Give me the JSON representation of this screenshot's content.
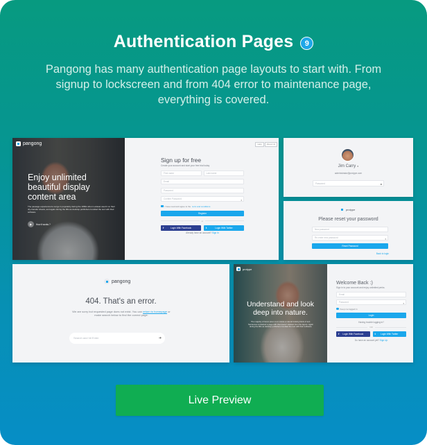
{
  "header": {
    "title": "Authentication Pages",
    "count_badge": "9",
    "subtitle": "Pangong has many authentication page layouts to start with. From signup to lockscreen and from 404 error to maintenance page, everything is covered."
  },
  "colors": {
    "gradient_top": "#079a80",
    "gradient_bottom": "#068ec6",
    "badge": "#1ea7e8",
    "primary_button": "#1aa7ec",
    "facebook_button": "#2c3f91",
    "live_preview_button": "#10ad52"
  },
  "previews": {
    "signup": {
      "brand": "pangong",
      "hero_title": "Enjoy unlimited beautiful display content area",
      "hero_text": "The passage experienced a surge in popularity during the 1960s when Letraset used it on their dry-transfer sheets, and again during the 90s as desktop publishers bundled the text with their software.",
      "how_it_works": "How it works ?",
      "top_buttons": [
        "Help",
        "About Us"
      ],
      "form_title": "Sign up for free",
      "form_subtitle": "Create your account and start your free trial today",
      "first_name_placeholder": "First name",
      "last_name_placeholder": "Last name",
      "email_placeholder": "Email",
      "password_placeholder": "Password",
      "confirm_password_placeholder": "Confirm Password",
      "terms_text": "I have read and agree to the",
      "terms_link": "term and conditions",
      "register_button": "Register",
      "or_label": "or",
      "facebook_button": "Login With Facebook",
      "twitter_button": "Login With Twitter",
      "have_account_text": "Already have an account?",
      "sign_in_link": "Sign In"
    },
    "lockscreen": {
      "name": "Jim Carry",
      "email": "administrator@protype.com",
      "password_placeholder": "Password"
    },
    "reset": {
      "brand": "protype",
      "title": "Please reset your password",
      "new_password_placeholder": "New password",
      "reenter_placeholder": "Re-enter new password",
      "reset_button": "Reset Password",
      "back_link": "Back to login"
    },
    "error404": {
      "brand": "pangong",
      "title": "404. That's an error.",
      "message_before": "We are sorry but requested page does not exist. You can",
      "return_link": "return to homepage",
      "message_after": "or make search below to find the correct page.",
      "search_placeholder": "Search and hit Enter"
    },
    "login": {
      "brand": "protype",
      "hero_title": "Understand and look deep into nature.",
      "hero_text": "The majority of lorem ipsum is in inside a natural looking block of text. Sentences contained a page with that doesn't distract from the layout. Again during the 90s as desktop publishers bundled the text with their software.",
      "form_title": "Welcome Back :)",
      "form_subtitle": "Sign in to your account and enjoy unlimited perks.",
      "email_placeholder": "Email",
      "password_placeholder": "Password",
      "keep_logged_in": "Keep me logged in",
      "login_button": "Login",
      "trouble_link": "Having trouble logging in?",
      "or_label": "OR",
      "facebook_button": "Login With Facebook",
      "twitter_button": "Login With Twitter",
      "no_account_text": "Do have an account yet?",
      "sign_up_link": "Sign Up"
    }
  },
  "cta": {
    "live_preview": "Live Preview"
  }
}
